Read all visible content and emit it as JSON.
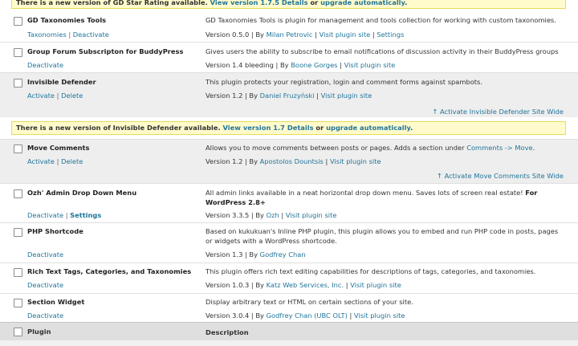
{
  "notices": {
    "top": {
      "prefix": "There is a new version of GD Star Rating available.",
      "view_link": "View version 1.7.5 Details",
      "or": "or",
      "upgrade_link": "upgrade automatically",
      "end": "."
    },
    "invisible_defender": {
      "prefix": "There is a new version of Invisible Defender available.",
      "view_link": "View version 1.7 Details",
      "or": "or",
      "upgrade_link": "upgrade automatically",
      "end": "."
    }
  },
  "plugins": [
    {
      "name": "GD Taxonomies Tools",
      "action1": "Taxonomies",
      "action2": "Deactivate",
      "description": "GD Taxonomies Tools is plugin for management and tools collection for working with custom taxonomies.",
      "version": "Version 0.5.0",
      "by": "By",
      "author": "Milan Petrovic",
      "site": "Visit plugin site",
      "extra": "Settings",
      "status": "active"
    },
    {
      "name": "Group Forum Subscripton for BuddyPress",
      "action1": "Deactivate",
      "description": "Gives users the ability to subscribe to email notifications of discussion activity in their BuddyPress groups",
      "version": "Version 1.4 bleeding",
      "by": "By",
      "author": "Boone Gorges",
      "site": "Visit plugin site",
      "status": "active"
    },
    {
      "name": "Invisible Defender",
      "action1": "Activate",
      "action2": "Delete",
      "description": "This plugin protects your registration, login and comment forms against spambots.",
      "version": "Version 1.2",
      "by": "By",
      "author": "Daniel Fruzyński",
      "site": "Visit plugin site",
      "sitewide": "↑ Activate Invisible Defender Site Wide",
      "status": "inactive"
    },
    {
      "name": "Move Comments",
      "action1": "Activate",
      "action2": "Delete",
      "description_prefix": "Allows you to move comments between posts or pages. Adds a section under",
      "description_link": "Comments -> Move",
      "description_suffix": ".",
      "version": "Version 1.2",
      "by": "By",
      "author": "Apostolos Dountsis",
      "site": "Visit plugin site",
      "sitewide": "↑ Activate Move Comments Site Wide",
      "status": "inactive"
    },
    {
      "name": "Ozh' Admin Drop Down Menu",
      "action1": "Deactivate",
      "action2": "Settings",
      "description_prefix": "All admin links available in a neat horizontal drop down menu. Saves lots of screen real estate!",
      "description_bold": "For WordPress 2.8+",
      "version": "Version 3.3.5",
      "by": "By",
      "author": "Ozh",
      "site": "Visit plugin site",
      "status": "active"
    },
    {
      "name": "PHP Shortcode",
      "action1": "Deactivate",
      "description": "Based on kukukuan's Inline PHP plugin, this plugin allows you to embed and run PHP code in posts, pages or widgets with a WordPress shortcode.",
      "version": "Version 1.3",
      "by": "By",
      "author": "Godfrey Chan",
      "status": "active"
    },
    {
      "name": "Rich Text Tags, Categories, and Taxonomies",
      "action1": "Deactivate",
      "description": "This plugin offers rich text editing capabilities for descriptions of tags, categories, and taxonomies.",
      "version": "Version 1.0.3",
      "by": "By",
      "author": "Katz Web Services, Inc.",
      "site": "Visit plugin site",
      "status": "active"
    },
    {
      "name": "Section Widget",
      "action1": "Deactivate",
      "description": "Display arbitrary text or HTML on certain sections of your site.",
      "version": "Version 3.0.4",
      "by": "By",
      "author": "Godfrey Chan (UBC OLT)",
      "site": "Visit plugin site",
      "status": "active"
    }
  ],
  "separator": "|",
  "footer": {
    "plugin_col": "Plugin",
    "description_col": "Description"
  },
  "colors": {
    "link": "#21759b",
    "notice_bg": "#fffbcc",
    "inactive_bg": "#eeeeee",
    "footer_bg": "#dfdfdf"
  }
}
